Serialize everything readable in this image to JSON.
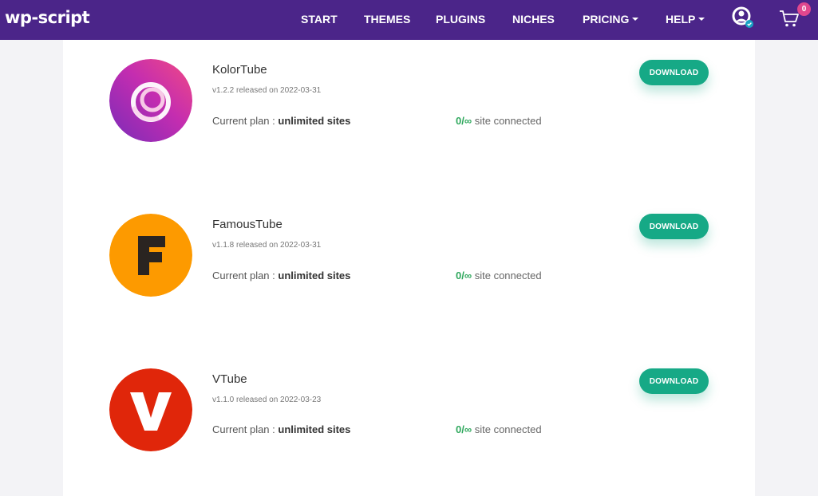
{
  "header": {
    "logo": "wp-script",
    "nav": [
      {
        "label": "START"
      },
      {
        "label": "THEMES"
      },
      {
        "label": "PLUGINS"
      },
      {
        "label": "NICHES"
      },
      {
        "label": "PRICING"
      },
      {
        "label": "HELP"
      }
    ],
    "cart_count": "0",
    "colors": {
      "bar": "#4b2589",
      "badge": "#e0478e"
    }
  },
  "products": [
    {
      "name": "KolorTube",
      "release": "v1.2.2 released on 2022-03-31",
      "plan_label": "Current plan : ",
      "plan_value": "unlimited sites",
      "sites_count": "0/∞",
      "sites_text": " site connected",
      "button": "DOWNLOAD",
      "icon": "kolortube-swirl-icon"
    },
    {
      "name": "FamousTube",
      "release": "v1.1.8 released on 2022-03-31",
      "plan_label": "Current plan : ",
      "plan_value": "unlimited sites",
      "sites_count": "0/∞",
      "sites_text": " site connected",
      "button": "DOWNLOAD",
      "icon": "famoustube-f-icon"
    },
    {
      "name": "VTube",
      "release": "v1.1.0 released on 2022-03-23",
      "plan_label": "Current plan : ",
      "plan_value": "unlimited sites",
      "sites_count": "0/∞",
      "sites_text": " site connected",
      "button": "DOWNLOAD",
      "icon": "vtube-v-icon"
    }
  ],
  "colors": {
    "download": "#16a986",
    "connected": "#2fa85d"
  }
}
